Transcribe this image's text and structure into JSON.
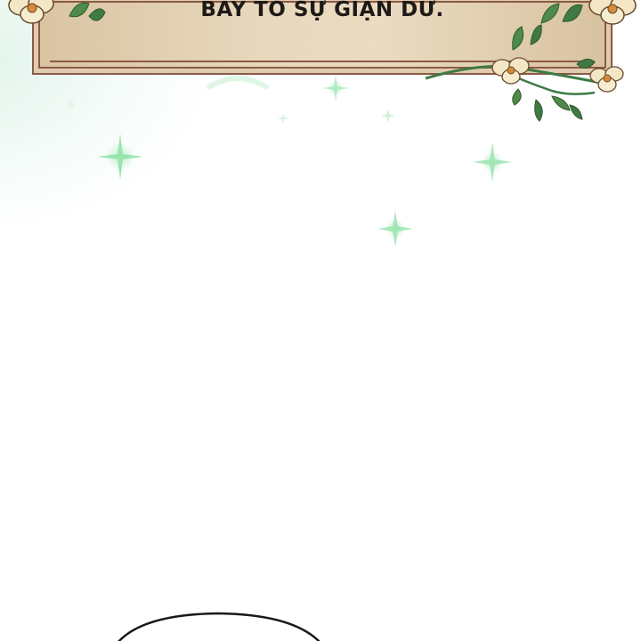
{
  "caption": {
    "text": "BAY TỎ SỰ GIẬN DỮ."
  },
  "colors": {
    "caption_bg": "#e8d8bd",
    "caption_border": "#8a5a44",
    "caption_text": "#1e1a18",
    "sparkle": "#7fd99a",
    "leaf": "#3f7a44",
    "flower": "#f3e7c6"
  },
  "icons": [
    "sparkle-icon",
    "flower-icon",
    "leaf-icon"
  ]
}
